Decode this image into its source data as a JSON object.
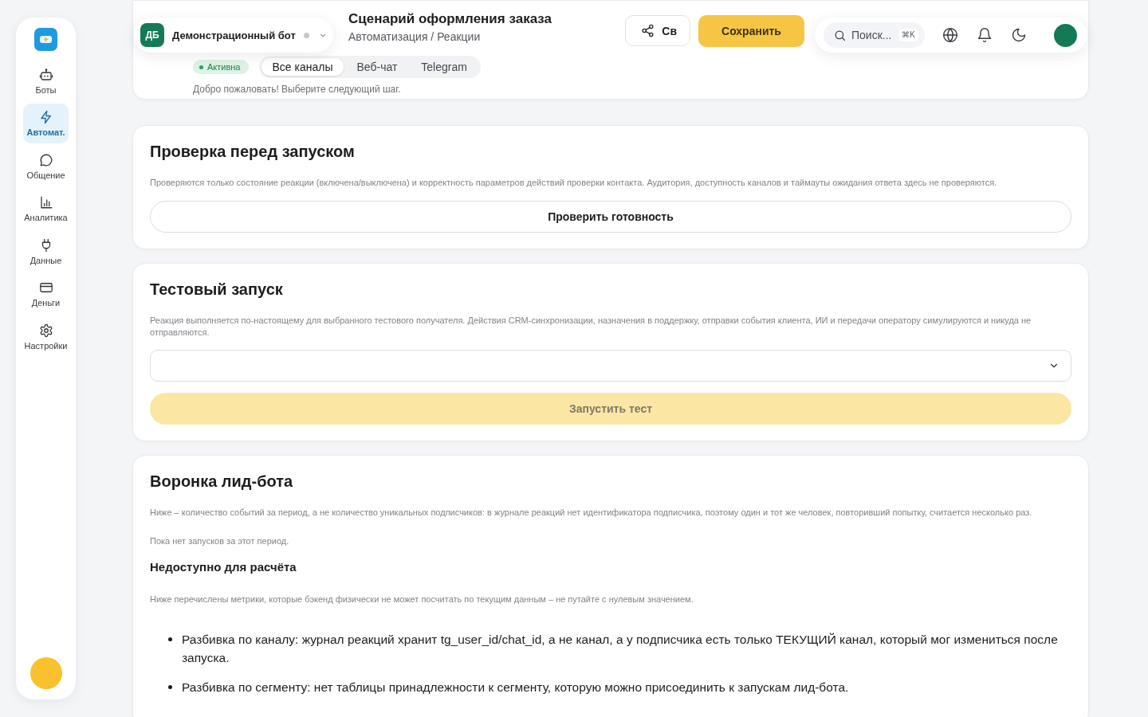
{
  "sidebar": {
    "items": [
      {
        "label": "Боты",
        "selected": false
      },
      {
        "label": "Автомат.",
        "selected": true
      },
      {
        "label": "Общение",
        "selected": false
      },
      {
        "label": "Аналитика",
        "selected": false
      },
      {
        "label": "Данные",
        "selected": false
      },
      {
        "label": "Деньги",
        "selected": false
      },
      {
        "label": "Настройки",
        "selected": false
      }
    ]
  },
  "topbar": {
    "bot": {
      "initials": "ДБ",
      "name": "Демонстрационный бот",
      "online": false
    },
    "breadcrumb": "Автоматизация / Реакции",
    "search": {
      "placeholder": "Поиск...",
      "shortcut": "⌘K"
    }
  },
  "header": {
    "title": "Сценарий оформления заказа",
    "status": {
      "label": "Активна",
      "active": true
    },
    "channel_tabs": [
      {
        "label": "Все каналы",
        "selected": true
      },
      {
        "label": "Веб-чат",
        "selected": false
      },
      {
        "label": "Telegram",
        "selected": false
      }
    ],
    "hint": "Добро пожаловать! Выберите следующий шаг.",
    "actions": [
      {
        "kind": "share",
        "label": "Св"
      },
      {
        "kind": "save",
        "label": "Сохранить"
      }
    ]
  },
  "readiness": {
    "title": "Проверка перед запуском",
    "description": "Проверяются только состояние реакции (включена/выключена) и корректность параметров действий проверки контакта. Аудитория, доступность каналов и таймауты ожидания ответа здесь не проверяются.",
    "button": "Проверить готовность"
  },
  "test_run": {
    "title": "Тестовый запуск",
    "description": "Реакция выполняется по-настоящему для выбранного тестового получателя. Действия CRM-синхронизации, назначения в поддержку, отправки события клиента, ИИ и передачи оператору симулируются и никуда не отправляются.",
    "button": {
      "label": "Запустить тест",
      "disabled": true
    }
  },
  "funnel": {
    "title": "Воронка лид-бота",
    "description": "Ниже – количество событий за период, а не количество уникальных подписчиков: в журнале реакций нет идентификатора подписчика, поэтому один и тот же человек, повторивший попытку, считается несколько раз.",
    "empty_note": "Пока нет запусков за этот период.",
    "unavailable": {
      "title": "Недоступно для расчёта",
      "description": "Ниже перечислены метрики, которые бэкенд физически не может посчитать по текущим данным – не путайте с нулевым значением.",
      "items": [
        "Разбивка по каналу: журнал реакций хранит tg_user_id/chat_id, а не канал, а у подписчика есть только ТЕКУЩИЙ канал, который мог измениться после запуска.",
        "Разбивка по сегменту: нет таблицы принадлежности к сегменту, которую можно присоединить к запускам лид-бота."
      ]
    }
  }
}
